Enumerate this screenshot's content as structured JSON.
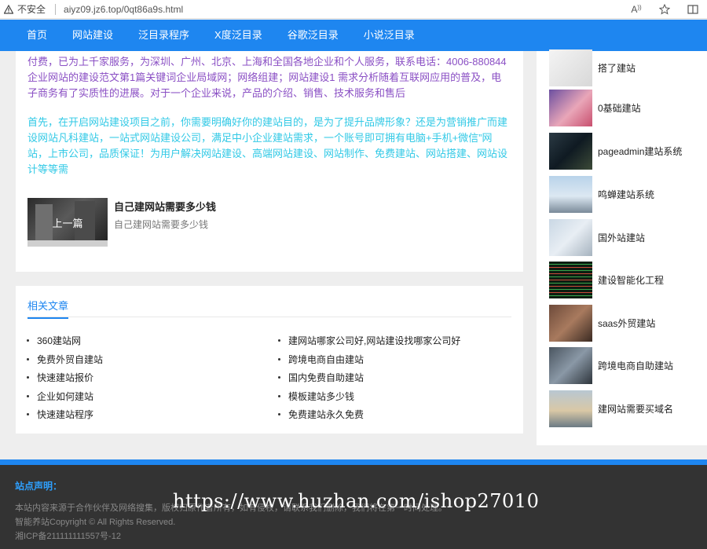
{
  "browser": {
    "security_label": "不安全",
    "url": "aiyz09.jz6.top/0qt86a9s.html",
    "read_aloud_label": "A",
    "favorite_icon": "star-icon",
    "split_icon": "split-screen-icon"
  },
  "nav": {
    "items": [
      "首页",
      "网站建设",
      "泛目录程序",
      "X度泛目录",
      "谷歌泛目录",
      "小说泛目录"
    ]
  },
  "article": {
    "para1": "付费，已为上千家服务，为深圳、广州、北京、上海和全国各地企业和个人服务，联系电话：4006-880844企业网站的建设范文第1篇关键词企业局域网；网络组建；网站建设1 需求分析随着互联网应用的普及，电子商务有了实质性的进展。对于一个企业来说，产品的介绍、销售、技术服务和售后",
    "para2": "首先，在开启网站建设项目之前，你需要明确好你的建站目的，是为了提升品牌形象？还是为营销推广而建设网站凡科建站，一站式网站建设公司，满足中小企业建站需求，一个账号即可拥有电脑+手机+微信”网站，上市公司，品质保证！为用户解决网站建设、高端网站建设、网站制作、免费建站、网站搭建、网站设计等等需",
    "prev": {
      "label": "上一篇",
      "title": "自己建网站需要多少钱",
      "desc": "自己建网站需要多少钱"
    }
  },
  "related": {
    "heading": "相关文章",
    "left": [
      "360建站网",
      "免费外贸自建站",
      "快速建站报价",
      "企业如何建站",
      "快速建站程序"
    ],
    "right": [
      "建网站哪家公司好,网站建设找哪家公司好",
      "跨境电商自由建站",
      "国内免费自助建站",
      "模板建站多少钱",
      "免费建站永久免费"
    ]
  },
  "sidebar": {
    "items": [
      {
        "label": "搭了建站"
      },
      {
        "label": "0基础建站"
      },
      {
        "label": "pageadmin建站系统"
      },
      {
        "label": "鸣蝉建站系统"
      },
      {
        "label": "国外站建站"
      },
      {
        "label": "建设智能化工程"
      },
      {
        "label": "saas外贸建站"
      },
      {
        "label": "跨境电商自助建站"
      },
      {
        "label": "建网站需要买域名"
      }
    ]
  },
  "footer": {
    "title": "站点声明：",
    "line1": "本站内容来源于合作伙伴及网络搜集，版权归原作者所有，如有侵权，请联系我们删除，我们将在第一时间处理。",
    "line2": "智能养站Copyright © All Rights Reserved.",
    "line3": "湘ICP备211111111557号-12"
  },
  "watermark": "https://www.huzhan.com/ishop27010",
  "colors": {
    "nav_blue": "#1e86f0",
    "para1": "#8a4fc4",
    "para2": "#31c9e6",
    "footer_bg": "#333333"
  }
}
